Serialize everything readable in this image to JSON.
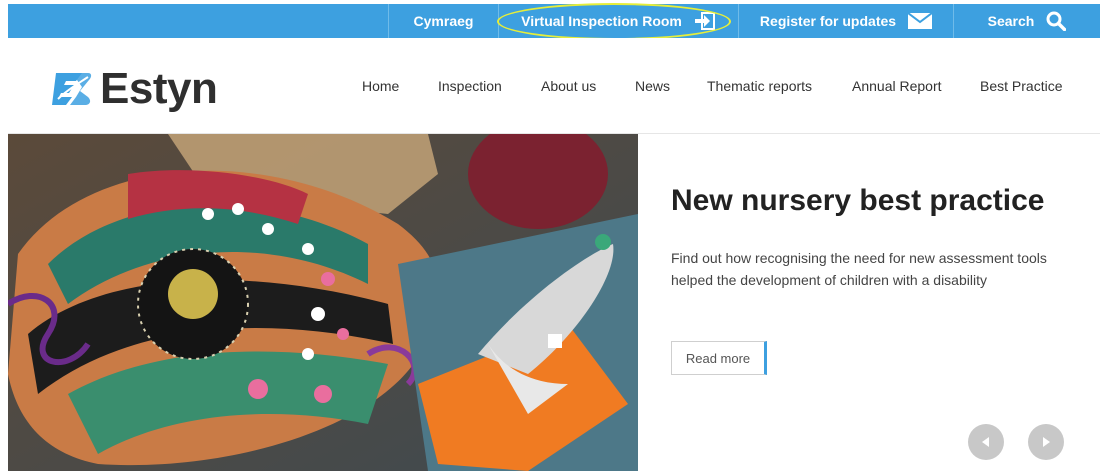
{
  "topbar": {
    "cymraeg": "Cymraeg",
    "virtual_inspection": "Virtual Inspection Room",
    "register": "Register for updates",
    "search": "Search",
    "icons": [
      "login-arrow-icon",
      "envelope-icon",
      "search-icon"
    ],
    "bg_color": "#3da0e0"
  },
  "logo": {
    "text": "Estyn",
    "icon": "estyn-logo-mark-icon",
    "color": "#3da0e0"
  },
  "nav": {
    "items": [
      "Home",
      "Inspection",
      "About us",
      "News",
      "Thematic reports",
      "Annual Report",
      "Best Practice"
    ]
  },
  "hero": {
    "title": "New nursery best practice",
    "description": "Find out how recognising the need for new assessment tools helped the development of children with a disability",
    "read_more": "Read more",
    "image": "children-craft-fish-artwork-photo",
    "controls": [
      "chevron-left-icon",
      "chevron-right-icon"
    ]
  }
}
